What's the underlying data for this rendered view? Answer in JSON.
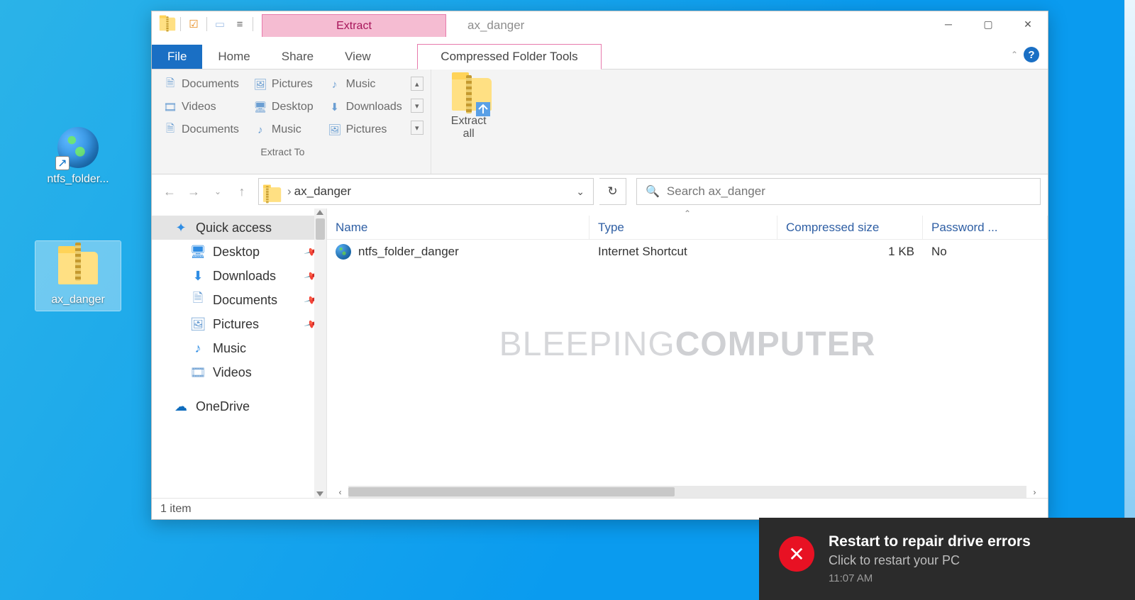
{
  "desktop": {
    "icon1_label": "ntfs_folder...",
    "icon2_label": "ax_danger"
  },
  "window": {
    "title": "ax_danger",
    "tabs": {
      "file": "File",
      "home": "Home",
      "share": "Share",
      "view": "View",
      "context": "Compressed Folder Tools",
      "context_head": "Extract"
    },
    "ribbon": {
      "items": [
        "Documents",
        "Pictures",
        "Music",
        "Videos",
        "Desktop",
        "Downloads",
        "Documents",
        "Music",
        "Pictures"
      ],
      "group_label": "Extract To",
      "extract_all_1": "Extract",
      "extract_all_2": "all"
    },
    "breadcrumb": "ax_danger",
    "search_placeholder": "Search ax_danger",
    "columns": {
      "name": "Name",
      "type": "Type",
      "compressed": "Compressed size",
      "password": "Password ..."
    },
    "rows": [
      {
        "name": "ntfs_folder_danger",
        "type": "Internet Shortcut",
        "compressed": "1 KB",
        "password": "No"
      }
    ],
    "status": "1 item"
  },
  "sidebar": {
    "quick_access": "Quick access",
    "desktop": "Desktop",
    "downloads": "Downloads",
    "documents": "Documents",
    "pictures": "Pictures",
    "music": "Music",
    "videos": "Videos",
    "onedrive": "OneDrive"
  },
  "toast": {
    "title": "Restart to repair drive errors",
    "subtitle": "Click to restart your PC",
    "time": "11:07 AM"
  },
  "watermark_a": "BLEEPING",
  "watermark_b": "COMPUTER"
}
